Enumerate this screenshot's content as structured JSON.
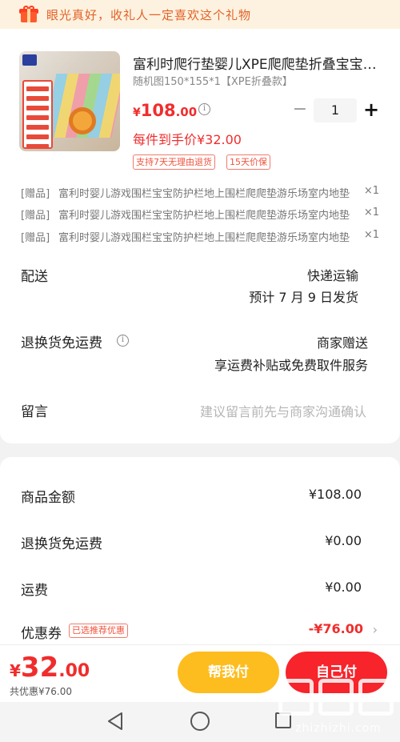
{
  "banner": {
    "text": "眼光真好，收礼人一定喜欢这个礼物"
  },
  "product": {
    "title": "富利时爬行垫婴儿XPE爬爬垫折叠宝宝家用拼接爬行垫",
    "spec": "随机图150*155*1【XPE折叠款】",
    "price_currency": "¥",
    "price_int": "108",
    "price_dec": ".00",
    "quantity": "1",
    "minus": "−",
    "plus": "+",
    "per_hand_price": "每件到手价¥32.00",
    "tags": [
      "支持7天无理由退货",
      "15天价保"
    ]
  },
  "gifts": [
    {
      "prefix": "[赠品]",
      "name": "富利时婴儿游戏围栏宝宝防护栏地上围栏爬爬垫游乐场室内地垫",
      "count": "×1"
    },
    {
      "prefix": "[赠品]",
      "name": "富利时婴儿游戏围栏宝宝防护栏地上围栏爬爬垫游乐场室内地垫",
      "count": "×1"
    },
    {
      "prefix": "[赠品]",
      "name": "富利时婴儿游戏围栏宝宝防护栏地上围栏爬爬垫游乐场室内地垫",
      "count": "×1"
    }
  ],
  "delivery": {
    "label": "配送",
    "method": "快递运输",
    "estimate": "预计 7 月 9 日发货"
  },
  "return_shipping": {
    "label": "退换货免运费",
    "value": "商家赠送",
    "detail": "享运费补贴或免费取件服务"
  },
  "message": {
    "label": "留言",
    "placeholder": "建议留言前先与商家沟通确认"
  },
  "summary": {
    "goods_label": "商品金额",
    "goods_value": "¥108.00",
    "return_label": "退换货免运费",
    "return_value": "¥0.00",
    "freight_label": "运费",
    "freight_value": "¥0.00",
    "coupon_label": "优惠券",
    "coupon_tag": "已选推荐优惠",
    "coupon_value": "-¥76.00"
  },
  "bottom": {
    "currency": "¥",
    "total_int": "32",
    "total_dec": ".00",
    "saved": "共优惠¥76.00",
    "help_pay": "帮我付",
    "self_pay": "自己付"
  },
  "watermark": {
    "text": "zhizhizhi.com"
  },
  "colors": {
    "accent_red": "#f02d2d",
    "help_yellow": "#fdbd1f",
    "pay_red": "#f7242b",
    "banner_bg": "#fdf2df"
  }
}
